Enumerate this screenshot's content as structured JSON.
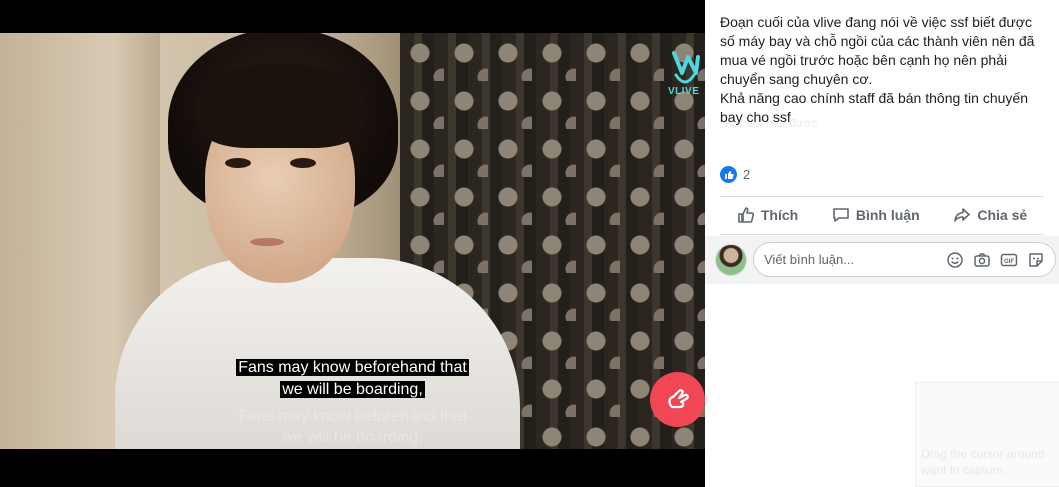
{
  "video": {
    "logo_text": "VLIVE",
    "caption_line1": "Fans may know beforehand that",
    "caption_line2": "we will be boarding,",
    "ghost_line1": "Fans may know beforehand that",
    "ghost_line2": "we will be boarding,"
  },
  "post": {
    "paragraph1": "Đoạn cuối của vlive đang nói về việc ssf biết được số máy bay và chỗ ngồi của các thành viên nên đã mua vé ngồi trước hoặc bên cạnh họ nên phải chuyển sang chuyên cơ.",
    "paragraph2": "Khả năng cao chính staff đã bán thông tin chuyến bay cho ssf",
    "reaction_count": "2",
    "like_label": "Thích",
    "comment_label": "Bình luận",
    "share_label": "Chia sẻ",
    "comment_placeholder": "Viết bình luận...",
    "ghost_text1": "việc ssf biết được",
    "ghost_text2": "Drag the cursor around",
    "ghost_text3": "want to capture."
  },
  "colors": {
    "accent": "#1877f2",
    "vlive": "#4fd6df",
    "heart_button": "#f14653"
  },
  "icons": [
    "vlive-icon",
    "heart-fingers-icon",
    "like-icon",
    "thumb-icon",
    "comment-icon",
    "share-icon",
    "emoji-icon",
    "camera-icon",
    "gif-icon",
    "sticker-icon"
  ]
}
